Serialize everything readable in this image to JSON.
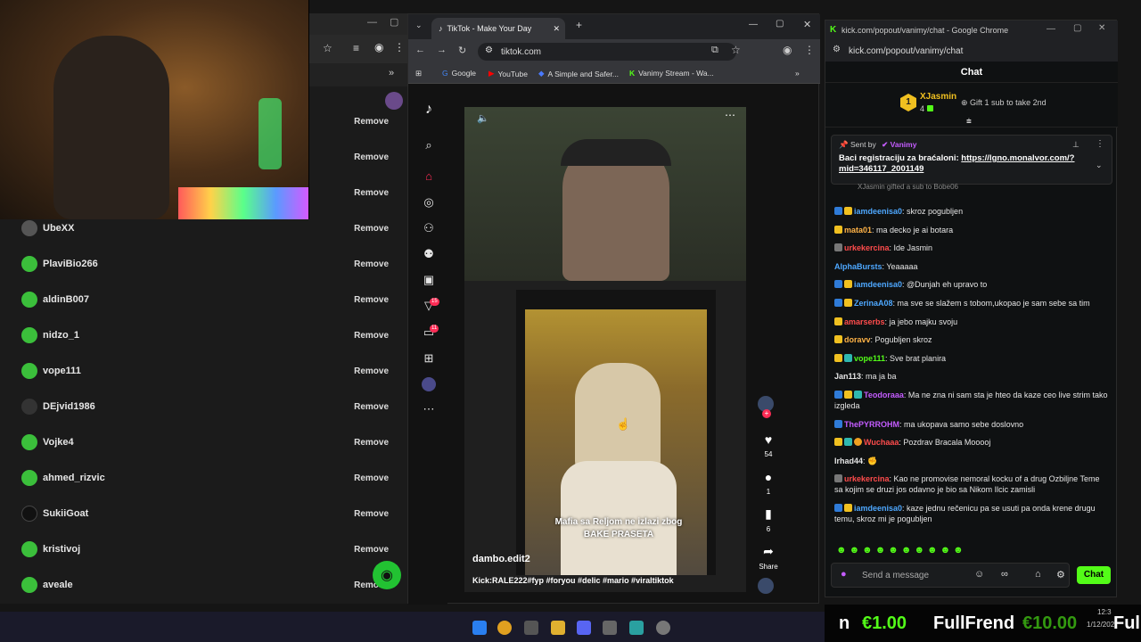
{
  "left_window": {
    "rows": [
      {
        "name": "",
        "action": "Remove"
      },
      {
        "name": "",
        "action": "Remove"
      },
      {
        "name": "",
        "action": "Remove"
      },
      {
        "name": "UbeXX",
        "action": "Remove"
      },
      {
        "name": "PlaviBio266",
        "action": "Remove"
      },
      {
        "name": "aldinB007",
        "action": "Remove"
      },
      {
        "name": "nidzo_1",
        "action": "Remove"
      },
      {
        "name": "vope111",
        "action": "Remove"
      },
      {
        "name": "DEjvid1986",
        "action": "Remove"
      },
      {
        "name": "Vojke4",
        "action": "Remove"
      },
      {
        "name": "ahmed_rizvic",
        "action": "Remove"
      },
      {
        "name": "SukiiGoat",
        "action": "Remove"
      },
      {
        "name": "kristivoj",
        "action": "Remove"
      },
      {
        "name": "aveale",
        "action": "Remove"
      }
    ]
  },
  "tiktok_window": {
    "tab_title": "TikTok - Make Your Day",
    "url": "tiktok.com",
    "bookmarks": [
      "Google",
      "YouTube",
      "A Simple and Safer...",
      "Vanimy Stream - Wa..."
    ],
    "badges": {
      "inbox": "15",
      "messages": "11"
    },
    "video": {
      "caption_overlay": "Mafia sa Reljom ne izlazi zbog BAKE PRASETA",
      "author": "dambo.edit2",
      "tags": "Kick:RALE222#fyp #foryou #delic #mario #viraltiktok"
    },
    "actions": {
      "likes": "54",
      "comments": "1",
      "saves": "6",
      "share": "Share"
    }
  },
  "chat_window": {
    "window_title": "kick.com/popout/vanimy/chat - Google Chrome",
    "url": "kick.com/popout/vanimy/chat",
    "header": "Chat",
    "leader": {
      "rank": "1",
      "name": "XJasmin",
      "count": "4",
      "gift_text": "Gift 1 sub to take 2nd"
    },
    "pinned": {
      "sent_by_label": "Sent by",
      "sender": "Vanimy",
      "text": "Baci registraciju za braćaloni: ",
      "link": "https://lgno.monalvor.com/?mid=346117_2001149",
      "below": "XJasmin gifted a sub to Bobe06"
    },
    "messages": [
      {
        "user": "iamdeenisa0",
        "color": "#4ea8ff",
        "text": ": skroz pogubljen"
      },
      {
        "user": "mata01",
        "color": "#ffb347",
        "text": ": ma decko je ai botara"
      },
      {
        "user": "urkekercina",
        "color": "#ff4c4c",
        "text": ": Ide Jasmin"
      },
      {
        "user": "AlphaBursts",
        "color": "#4ea8ff",
        "text": ": Yeaaaaa"
      },
      {
        "user": "iamdeenisa0",
        "color": "#4ea8ff",
        "text": ": @Dunjah eh upravo to"
      },
      {
        "user": "ZerinaA08",
        "color": "#4ea8ff",
        "text": ": ma sve se slažem s tobom,ukopao je sam sebe sa tim"
      },
      {
        "user": "amarserbs",
        "color": "#ff4c4c",
        "text": ": ja jebo majku svoju"
      },
      {
        "user": "doravv",
        "color": "#ffb347",
        "text": ": Pogubljen skroz"
      },
      {
        "user": "vope111",
        "color": "#53fc18",
        "text": ": Sve brat planira"
      },
      {
        "user": "Jan113",
        "color": "#e6e6e6",
        "text": ": ma ja ba"
      },
      {
        "user": "Teodoraaa",
        "color": "#c45cff",
        "text": ": Ma ne zna ni sam sta je hteo da kaze ceo live strim tako izgleda"
      },
      {
        "user": "ThePYRROHM",
        "color": "#c45cff",
        "text": ": ma ukopava samo sebe doslovno"
      },
      {
        "user": "Wuchaaa",
        "color": "#ff4c4c",
        "text": ": Pozdrav Bracala Mooooj"
      },
      {
        "user": "Irhad44",
        "color": "#e6e6e6",
        "text": ":"
      },
      {
        "user": "urkekercina",
        "color": "#ff4c4c",
        "text": ": Kao ne promovise nemoral kocku of a drug Ozbiljne Teme sa kojim se druzi jos odavno je bio sa Nikom Ilcic zamisli"
      },
      {
        "user": "iamdeenisa0",
        "color": "#4ea8ff",
        "text": ": kaze jednu rečenicu pa se usuti pa onda krene drugu temu, skroz mi je pogubljen"
      }
    ],
    "input_placeholder": "Send a message",
    "send_label": "Chat"
  },
  "overlay": {
    "amount_1": "€1.00",
    "name": "FullFrend",
    "amount_2": "€10.00",
    "name_short": "Ful"
  },
  "taskbar": {
    "time": "12:3",
    "date": "1/12/202"
  }
}
